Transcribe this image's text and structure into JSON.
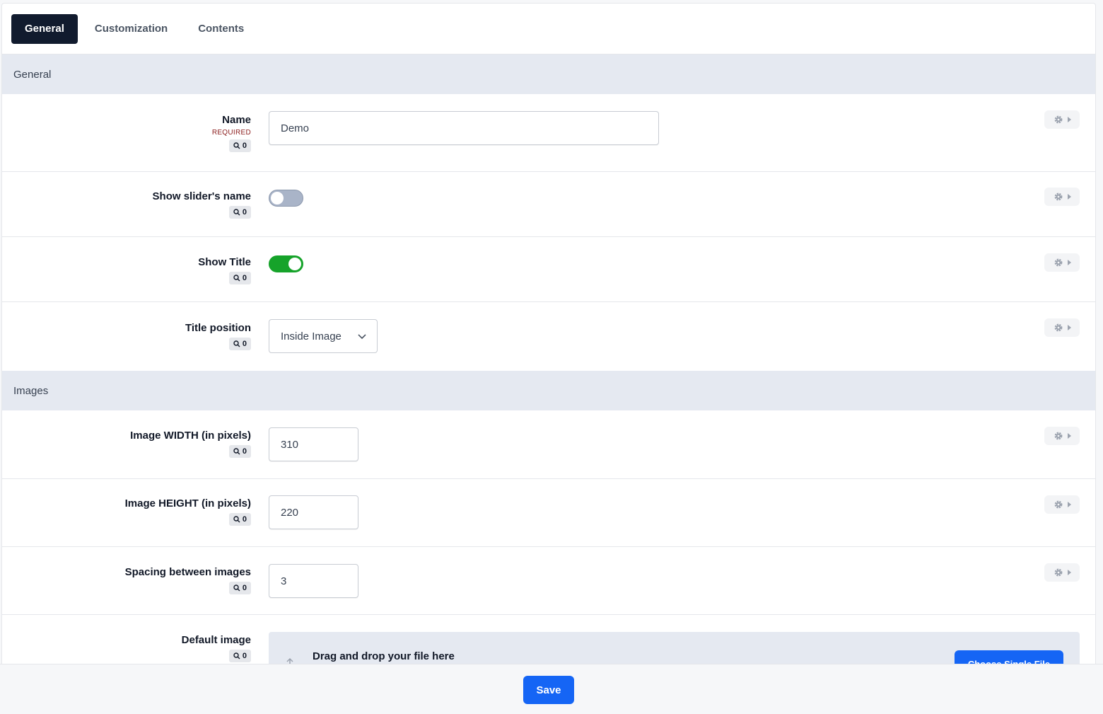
{
  "tabs": [
    {
      "label": "General",
      "active": true
    },
    {
      "label": "Customization",
      "active": false
    },
    {
      "label": "Contents",
      "active": false
    }
  ],
  "sections": {
    "general": {
      "title": "General"
    },
    "images": {
      "title": "Images"
    }
  },
  "fields": {
    "name": {
      "label": "Name",
      "required": "REQUIRED",
      "badge": "0",
      "value": "Demo"
    },
    "show_slider_name": {
      "label": "Show slider's name",
      "badge": "0",
      "enabled": false
    },
    "show_title": {
      "label": "Show Title",
      "badge": "0",
      "enabled": true
    },
    "title_position": {
      "label": "Title position",
      "badge": "0",
      "value": "Inside Image"
    },
    "image_width": {
      "label": "Image WIDTH (in pixels)",
      "badge": "0",
      "value": "310"
    },
    "image_height": {
      "label": "Image HEIGHT (in pixels)",
      "badge": "0",
      "value": "220"
    },
    "spacing": {
      "label": "Spacing between images",
      "badge": "0",
      "value": "3"
    },
    "default_image": {
      "label": "Default image",
      "badge": "0",
      "drop_text": "Drag and drop your file here",
      "choose_label": "Choose Single File"
    }
  },
  "icons": {
    "badge": "search-icon",
    "row_action": "gear-icon",
    "row_action_caret": "caret-right-icon",
    "select": "chevron-down-icon",
    "upload": "arrow-up-icon"
  },
  "colors": {
    "active_tab": "#111b2e",
    "primary": "#1565f5",
    "toggle_on": "#16a32a",
    "required": "#8b1c1c"
  },
  "footer": {
    "save_label": "Save"
  }
}
